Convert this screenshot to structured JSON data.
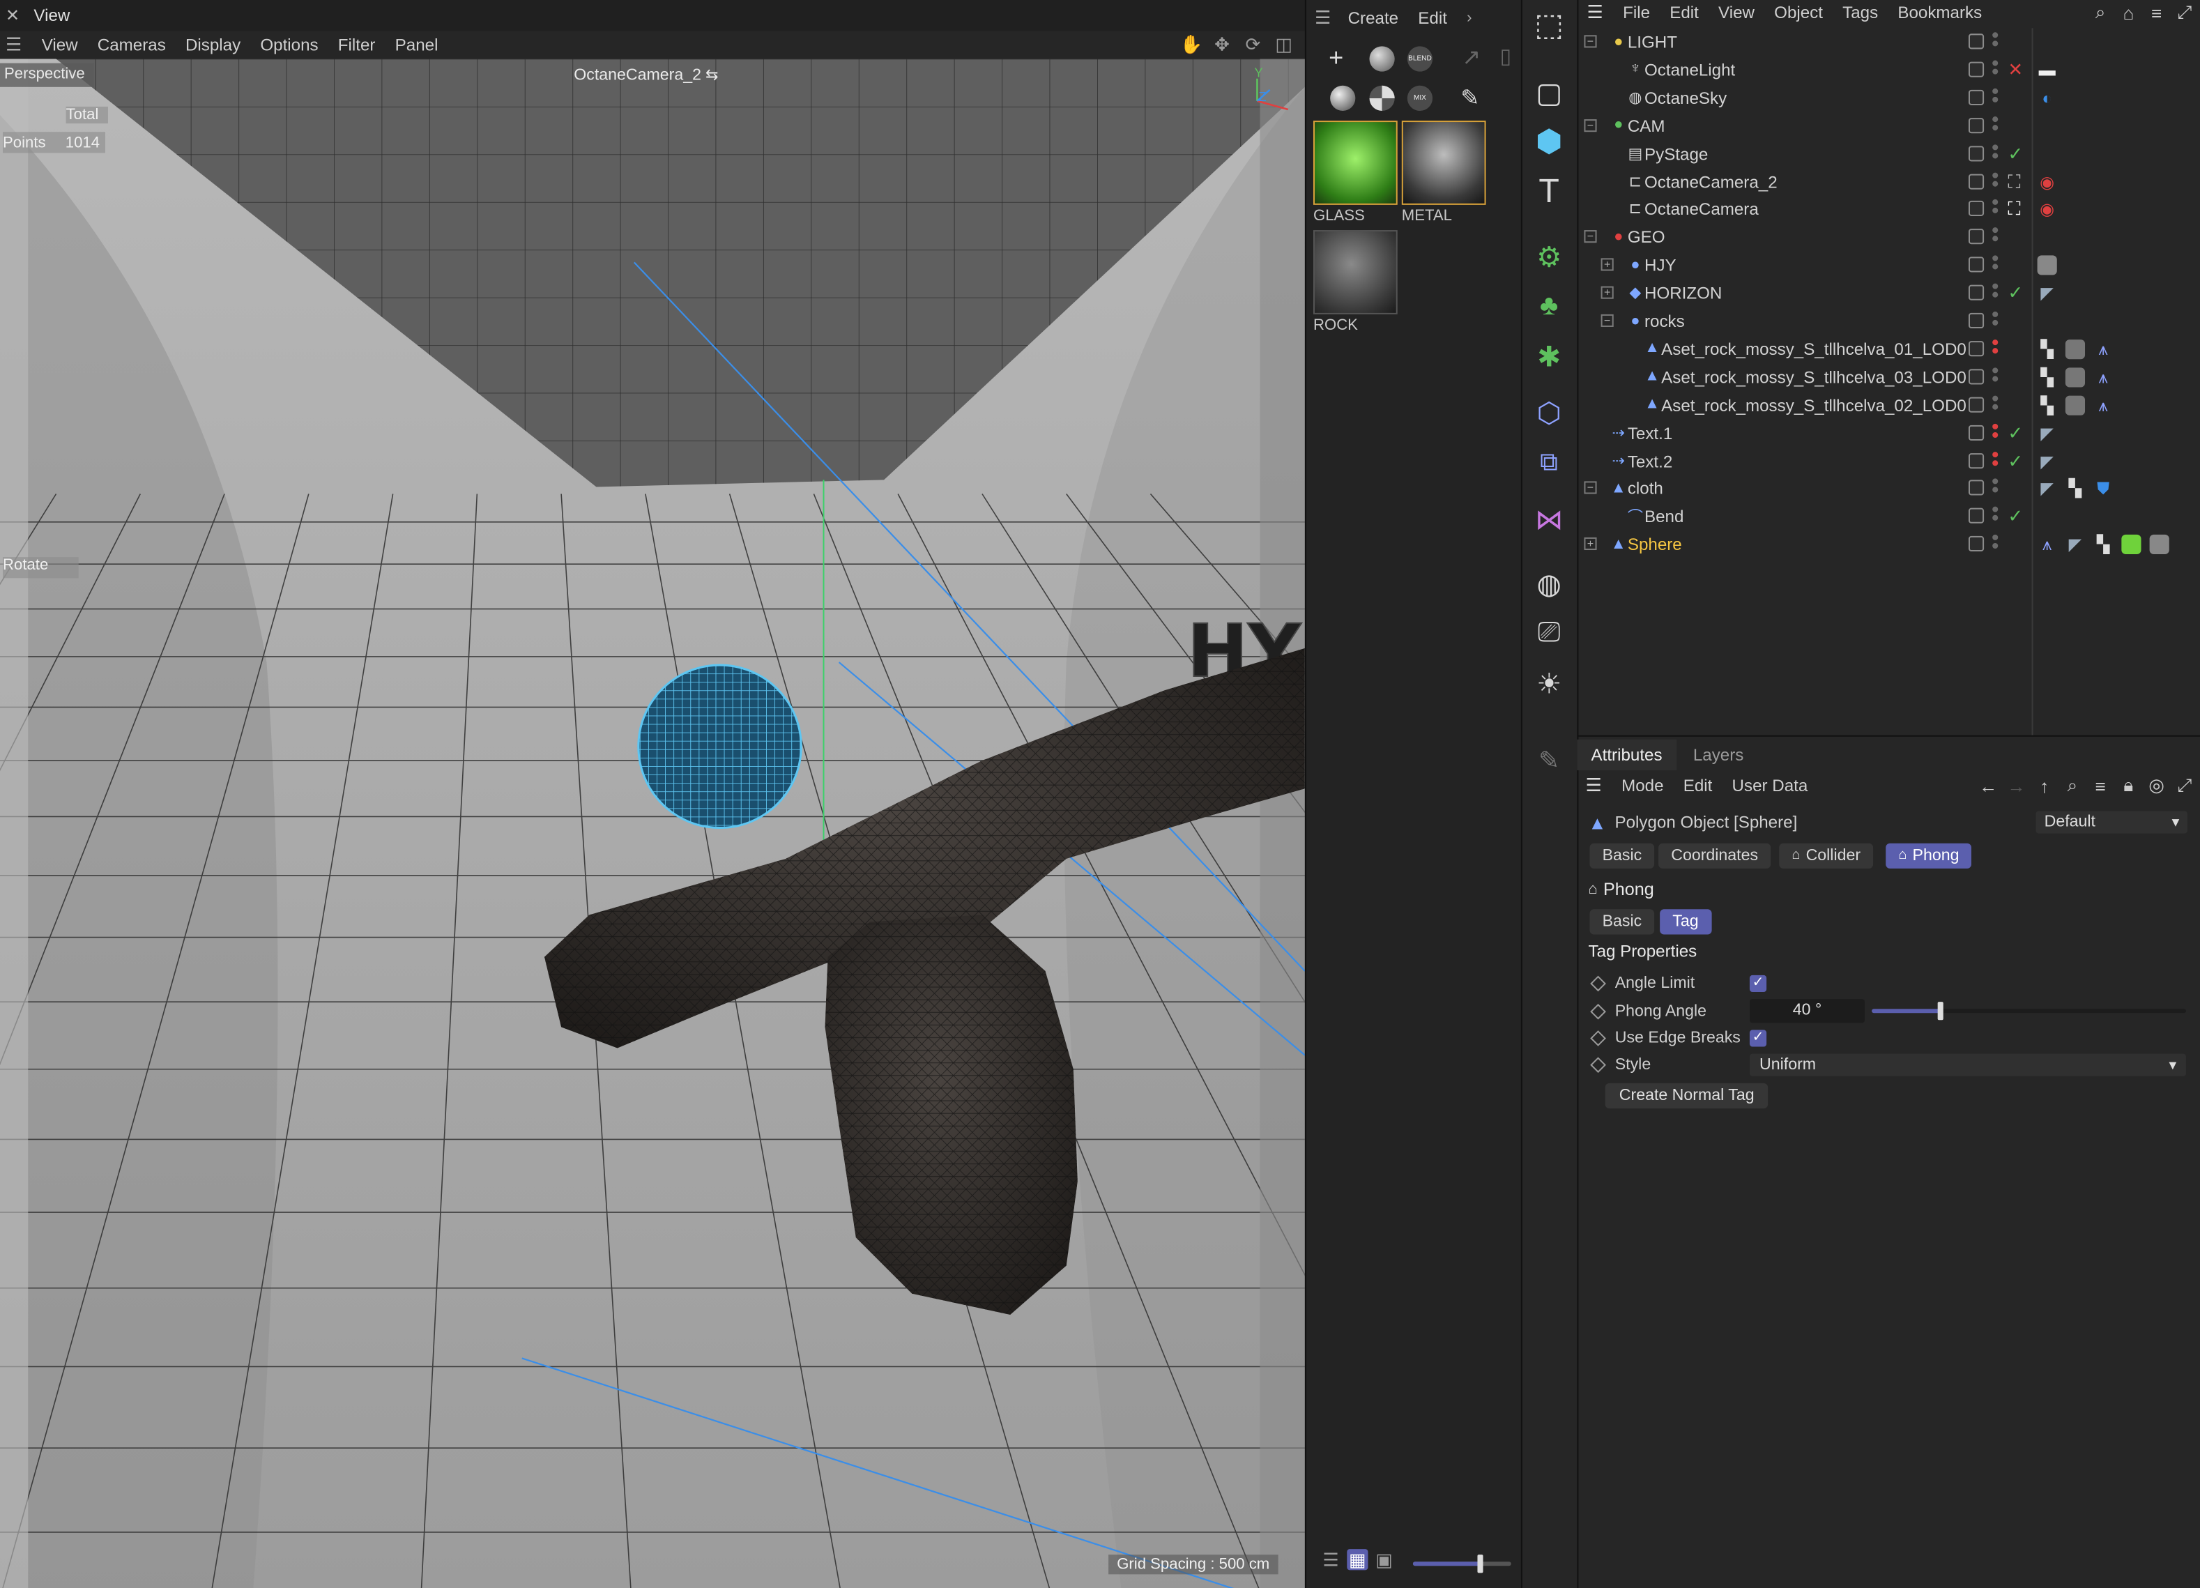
{
  "window": {
    "title": "View"
  },
  "viewport_menu": [
    "View",
    "Cameras",
    "Display",
    "Options",
    "Filter",
    "Panel"
  ],
  "viewport": {
    "projection": "Perspective",
    "camera": "OctaneCamera_2",
    "hud_total": "Total",
    "hud_points_label": "Points",
    "hud_points_value": "1014",
    "hud_mode": "Rotate",
    "grid_spacing": "Grid Spacing : 500 cm",
    "axis_y": "Y",
    "axis_z": "Z",
    "text_logo": "HY"
  },
  "material_manager": {
    "menu": [
      "Create",
      "Edit"
    ],
    "materials": [
      {
        "name": "GLASS",
        "color": "#6fd23b"
      },
      {
        "name": "METAL",
        "color": "#777777"
      },
      {
        "name": "ROCK",
        "color": "#5d5d5d"
      }
    ],
    "toolbar_icons": [
      "plus-icon",
      "sphere-icon",
      "blend-icon",
      "arrow-icon",
      "trash-icon",
      "sphere-icon",
      "checker-sphere-icon",
      "mix-icon",
      "eyedropper-icon"
    ],
    "toolbar_labels": {
      "blend": "BLEND",
      "mix": "MIX"
    }
  },
  "tool_palette": [
    "live-selection-icon",
    "rectangle-icon",
    "cube-icon",
    "text-icon",
    "generator-icon",
    "cloner-icon",
    "gear-icon",
    "deformer-icon",
    "field-icon",
    "spline-icon",
    "globe-icon",
    "camera-icon",
    "sun-icon",
    "pen-icon"
  ],
  "object_manager": {
    "menu": [
      "File",
      "Edit",
      "View",
      "Object",
      "Tags",
      "Bookmarks"
    ],
    "rows": [
      {
        "name": "LIGHT",
        "depth": 0,
        "icon": "null-icon",
        "color": "#e8c94b",
        "expander": "−",
        "status": "",
        "dots": "gray"
      },
      {
        "name": "OctaneLight",
        "depth": 1,
        "icon": "light-icon",
        "color": "#cfcfcf",
        "expander": "",
        "status": "✕",
        "status_color": "#e04040",
        "dots": "gray"
      },
      {
        "name": "OctaneSky",
        "depth": 1,
        "icon": "sky-icon",
        "color": "#cfcfcf",
        "expander": "",
        "status": "",
        "dots": "gray"
      },
      {
        "name": "CAM",
        "depth": 0,
        "icon": "null-icon",
        "color": "#5ec15e",
        "expander": "−",
        "status": "",
        "dots": "gray"
      },
      {
        "name": "PyStage",
        "depth": 1,
        "icon": "stage-icon",
        "color": "#cfcfcf",
        "expander": "",
        "status": "✓",
        "status_color": "#5ec15e",
        "dots": "gray"
      },
      {
        "name": "OctaneCamera_2",
        "depth": 1,
        "icon": "camera-icon",
        "color": "#cfcfcf",
        "expander": "",
        "status": "⛶",
        "status_color": "#bbbbbb",
        "dots": "gray"
      },
      {
        "name": "OctaneCamera",
        "depth": 1,
        "icon": "camera-icon",
        "color": "#cfcfcf",
        "expander": "",
        "status": "⛶",
        "status_color": "#ffffff",
        "dots": "gray"
      },
      {
        "name": "GEO",
        "depth": 0,
        "icon": "null-icon",
        "color": "#e04040",
        "expander": "−",
        "status": "",
        "dots": "gray"
      },
      {
        "name": "HJY",
        "depth": 1,
        "icon": "null-icon",
        "color": "#7ea7ff",
        "expander": "+",
        "status": "",
        "dots": "gray"
      },
      {
        "name": "HORIZON",
        "depth": 1,
        "icon": "plane-icon",
        "color": "#7ea7ff",
        "expander": "+",
        "status": "✓",
        "status_color": "#5ec15e",
        "dots": "gray"
      },
      {
        "name": "rocks",
        "depth": 1,
        "icon": "null-icon",
        "color": "#7ea7ff",
        "expander": "−",
        "status": "",
        "dots": "gray"
      },
      {
        "name": "Aset_rock_mossy_S_tllhcelva_01_LOD0",
        "depth": 2,
        "icon": "polygon-icon",
        "color": "#7ea7ff",
        "expander": "",
        "status": "",
        "dots": "red"
      },
      {
        "name": "Aset_rock_mossy_S_tllhcelva_03_LOD0",
        "depth": 2,
        "icon": "polygon-icon",
        "color": "#7ea7ff",
        "expander": "",
        "status": "",
        "dots": "gray"
      },
      {
        "name": "Aset_rock_mossy_S_tllhcelva_02_LOD0",
        "depth": 2,
        "icon": "polygon-icon",
        "color": "#7ea7ff",
        "expander": "",
        "status": "",
        "dots": "gray"
      },
      {
        "name": "Text.1",
        "depth": 0,
        "icon": "text-icon",
        "color": "#7ea7ff",
        "expander": "",
        "status": "✓",
        "status_color": "#5ec15e",
        "dots": "red"
      },
      {
        "name": "Text.2",
        "depth": 0,
        "icon": "text-icon",
        "color": "#7ea7ff",
        "expander": "",
        "status": "✓",
        "status_color": "#5ec15e",
        "dots": "red"
      },
      {
        "name": "cloth",
        "depth": 0,
        "icon": "polygon-icon",
        "color": "#7ea7ff",
        "expander": "−",
        "status": "",
        "dots": "gray"
      },
      {
        "name": "Bend",
        "depth": 1,
        "icon": "bend-icon",
        "color": "#7ea7ff",
        "expander": "",
        "status": "✓",
        "status_color": "#5ec15e",
        "dots": "gray"
      },
      {
        "name": "Sphere",
        "depth": 0,
        "icon": "polygon-icon",
        "color": "#7ea7ff",
        "expander": "+",
        "status": "",
        "dots": "gray",
        "selected": true
      }
    ]
  },
  "attributes": {
    "tabs": [
      "Attributes",
      "Layers"
    ],
    "menu": [
      "Mode",
      "Edit",
      "User Data"
    ],
    "object_title": "Polygon Object [Sphere]",
    "preset": "Default",
    "object_tabs": [
      "Basic",
      "Coordinates",
      "Collider",
      "Phong"
    ],
    "section_title": "Phong",
    "sub_tabs": [
      "Basic",
      "Tag"
    ],
    "group_title": "Tag Properties",
    "props": {
      "angle_limit_label": "Angle Limit",
      "phong_angle_label": "Phong Angle",
      "phong_angle_value": "40 °",
      "phong_angle_fraction": 0.22,
      "edge_breaks_label": "Use Edge Breaks",
      "style_label": "Style",
      "style_value": "Uniform"
    },
    "create_button": "Create Normal Tag"
  }
}
